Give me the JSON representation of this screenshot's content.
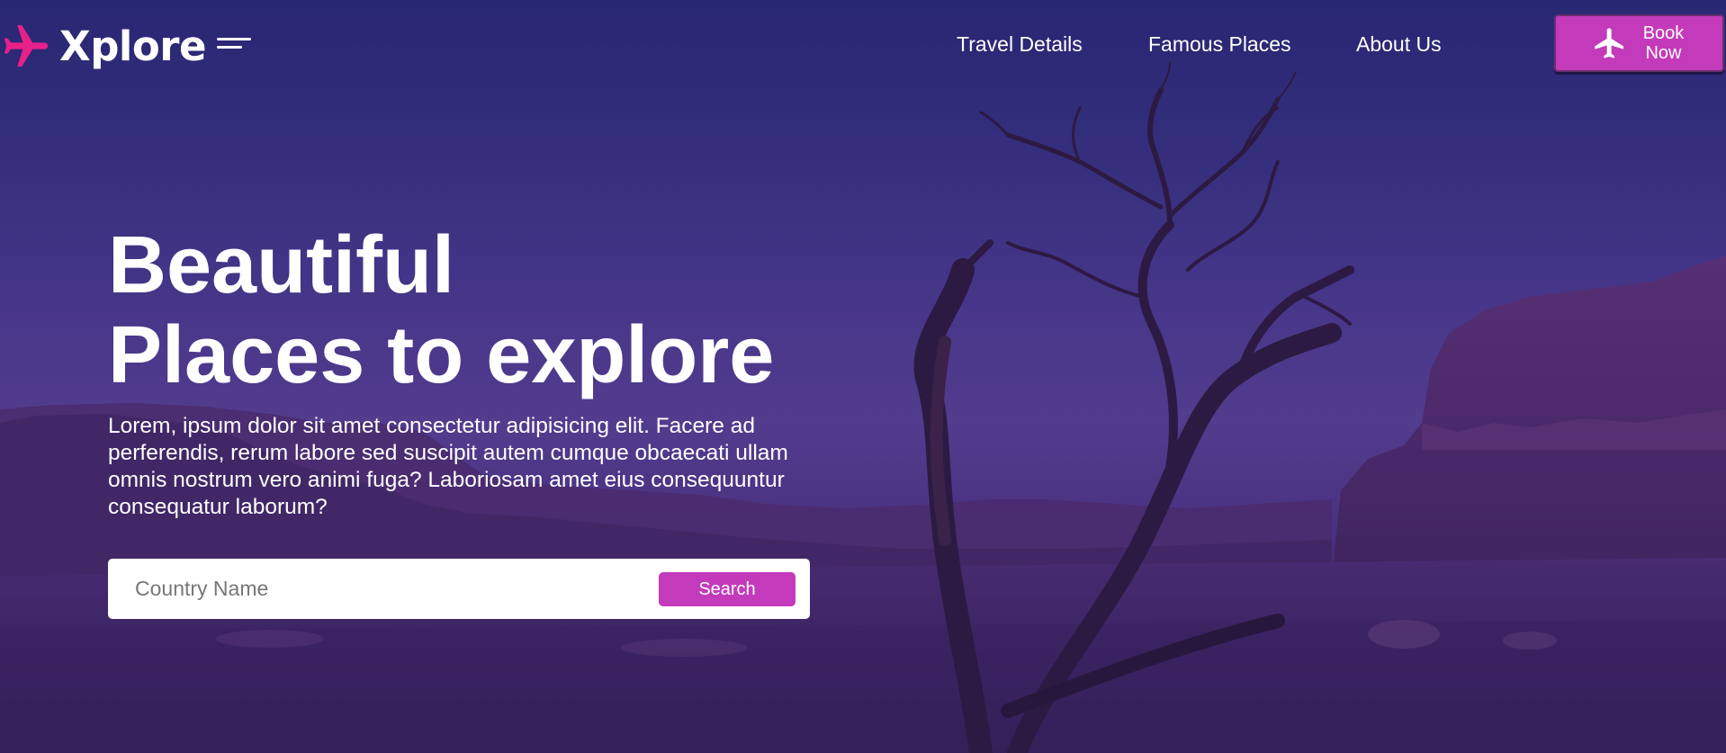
{
  "brand": {
    "name": "Xplore",
    "accent_color": "#e8208a",
    "logo_icon": "airplane-icon",
    "menu_icon": "hamburger-menu-icon"
  },
  "nav": {
    "links": [
      {
        "label": "Travel Details"
      },
      {
        "label": "Famous Places"
      },
      {
        "label": "About Us"
      }
    ],
    "cta": {
      "label": "Book Now",
      "icon": "airplane-icon",
      "color": "#c33aba"
    }
  },
  "hero": {
    "headline_line1": "Beautiful",
    "headline_line2": "Places to explore",
    "description": "Lorem, ipsum dolor sit amet consectetur adipisicing elit. Facere ad perferendis, rerum labore sed suscipit autem cumque obcaecati ullam omnis nostrum vero animi fuga? Laboriosam amet eius consequuntur consequatur laborum?",
    "background_image": "desert-mesa-dead-tree-photo"
  },
  "search": {
    "placeholder": "Country Name",
    "value": "",
    "button_label": "Search",
    "button_color": "#c33aba"
  }
}
